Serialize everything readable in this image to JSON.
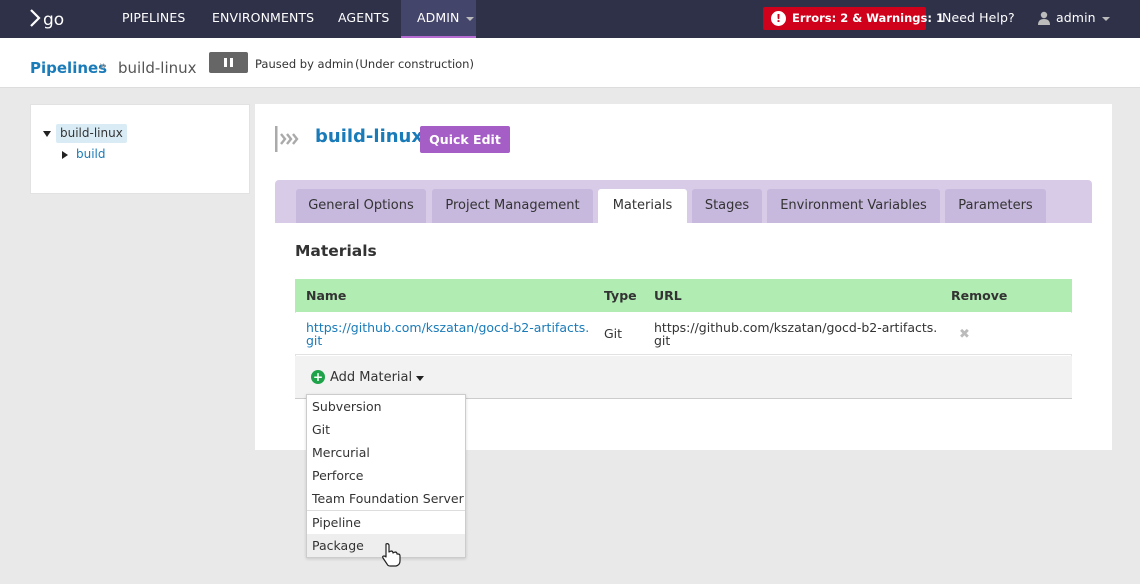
{
  "nav": {
    "logo_text": "go",
    "items": [
      {
        "label": "PIPELINES"
      },
      {
        "label": "ENVIRONMENTS"
      },
      {
        "label": "AGENTS"
      },
      {
        "label": "ADMIN"
      }
    ],
    "errors_badge": "Errors: 2 & Warnings: 1",
    "help_label": "Need Help?",
    "user_label": "admin"
  },
  "header": {
    "breadcrumb_root": "Pipelines",
    "breadcrumb_sep": "»",
    "breadcrumb_current": "build-linux",
    "paused_text": "Paused by admin",
    "status_note": "(Under construction)"
  },
  "tree": {
    "root": "build-linux",
    "child": "build"
  },
  "pipeline": {
    "title": "build-linux",
    "quick_edit_label": "Quick Edit"
  },
  "tabs": [
    {
      "label": "General Options"
    },
    {
      "label": "Project Management"
    },
    {
      "label": "Materials"
    },
    {
      "label": "Stages"
    },
    {
      "label": "Environment Variables"
    },
    {
      "label": "Parameters"
    }
  ],
  "active_tab": "Materials",
  "materials": {
    "section_title": "Materials",
    "columns": [
      "Name",
      "Type",
      "URL",
      "Remove"
    ],
    "rows": [
      {
        "name_line1": "https://github.com/kszatan/gocd-b2-artifacts.",
        "name_line2": "git",
        "type": "Git",
        "url_line1": "https://github.com/kszatan/gocd-b2-artifacts.",
        "url_line2": "git",
        "remove": "✖"
      }
    ],
    "add_label": "Add Material",
    "add_icon": "+"
  },
  "dropdown": {
    "options": [
      "Subversion",
      "Git",
      "Mercurial",
      "Perforce",
      "Team Foundation Server",
      "Pipeline",
      "Package"
    ],
    "hovered": "Package"
  },
  "colors": {
    "nav_bg": "#2f3149",
    "link": "#1a7bb9",
    "quick_edit": "#a45ec6",
    "table_header": "#b1ecb3",
    "error": "#d0021b"
  },
  "icons": [
    "go-logo-icon",
    "error-icon",
    "user-icon",
    "pause-icon",
    "pipeline-icon",
    "plus-circle-icon",
    "remove-icon",
    "caret-down-icon",
    "pointer-cursor-icon"
  ]
}
